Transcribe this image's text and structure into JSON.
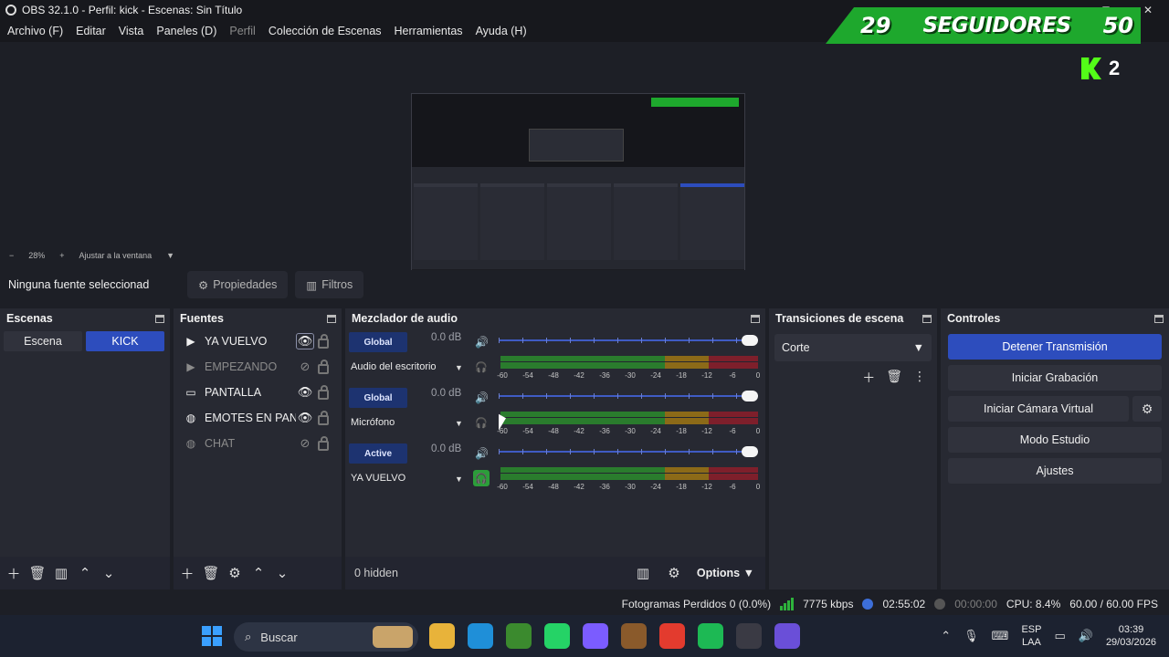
{
  "window": {
    "title": "OBS 32.1.0 - Perfil: kick - Escenas: Sin Título",
    "min_glyph": "—",
    "max_glyph": "▢",
    "close_glyph": "✕"
  },
  "menu": [
    "Archivo (F)",
    "Editar",
    "Vista",
    "Paneles (D)",
    "Perfil",
    "Colección de Escenas",
    "Herramientas",
    "Ayuda (H)"
  ],
  "overlay": {
    "left_count": "29",
    "label": "SEGUIDORES",
    "goal": "50",
    "kick_count": "2",
    "colors": {
      "banner": "#1ea82d",
      "kick": "#53fc18"
    }
  },
  "zoom": {
    "minus": "−",
    "level": "28%",
    "plus": "+",
    "fit_label": "Ajustar a la ventana",
    "dropdown": "▼"
  },
  "context": {
    "label": "Ninguna fuente seleccionad",
    "properties_label": "Propiedades",
    "filters_label": "Filtros"
  },
  "scenes": {
    "title": "Escenas",
    "items": [
      "Escena",
      "KICK"
    ],
    "active": "KICK"
  },
  "sources": {
    "title": "Fuentes",
    "items": [
      {
        "name": "YA VUELVO",
        "icon": "play-icon",
        "glyph": "▶",
        "visible": true
      },
      {
        "name": "EMPEZANDO",
        "icon": "play-icon",
        "glyph": "▶",
        "visible": false
      },
      {
        "name": "PANTALLA",
        "icon": "monitor-icon",
        "glyph": "▭",
        "visible": true
      },
      {
        "name": "EMOTES EN PANT",
        "icon": "browser-icon",
        "glyph": "◍",
        "visible": true
      },
      {
        "name": "CHAT",
        "icon": "browser-icon",
        "glyph": "◍",
        "visible": false
      }
    ]
  },
  "mixer": {
    "title": "Mezclador de audio",
    "scale": [
      "-60",
      "-54",
      "-48",
      "-42",
      "-36",
      "-30",
      "-24",
      "-18",
      "-12",
      "-6",
      "0"
    ],
    "channels": [
      {
        "badge": "Global",
        "db": "0.0 dB",
        "name": "Audio del escritorio",
        "monitor": false,
        "volume": 1.0
      },
      {
        "badge": "Global",
        "db": "0.0 dB",
        "name": "Micrófono",
        "monitor": false,
        "volume": 1.0
      },
      {
        "badge": "Active",
        "db": "0.0 dB",
        "name": "YA VUELVO",
        "monitor": true,
        "volume": 1.0
      }
    ],
    "footer": {
      "hidden": "0 hidden",
      "options": "Options"
    }
  },
  "transitions": {
    "title": "Transiciones de escena",
    "selected": "Corte"
  },
  "controls": {
    "title": "Controles",
    "stream": "Detener Transmisión",
    "record": "Iniciar Grabación",
    "virtualcam": "Iniciar Cámara Virtual",
    "studio": "Modo Estudio",
    "settings": "Ajustes"
  },
  "status": {
    "dropped": "Fotogramas Perdidos 0 (0.0%)",
    "bitrate": "7775 kbps",
    "stream_time": "02:55:02",
    "record_time": "00:00:00",
    "cpu": "CPU: 8.4%",
    "fps": "60.00 / 60.00 FPS"
  },
  "taskbar": {
    "search": "Buscar",
    "apps": [
      {
        "name": "file-explorer",
        "color": "#e8b33a"
      },
      {
        "name": "edge",
        "color": "#1f8fd8"
      },
      {
        "name": "minecraft",
        "color": "#3b8a2e"
      },
      {
        "name": "whatsapp",
        "color": "#25d366"
      },
      {
        "name": "copilot",
        "color": "#7b5cff"
      },
      {
        "name": "minecraft-dungeons",
        "color": "#8a5a2b"
      },
      {
        "name": "chrome",
        "color": "#e33b2e"
      },
      {
        "name": "spotify",
        "color": "#1db954"
      },
      {
        "name": "obs",
        "color": "#3a3a44"
      },
      {
        "name": "chat-app",
        "color": "#6a4fd8"
      }
    ],
    "lang": "ESP",
    "region": "LAA",
    "time": "03:39",
    "date": "29/03/2026"
  }
}
